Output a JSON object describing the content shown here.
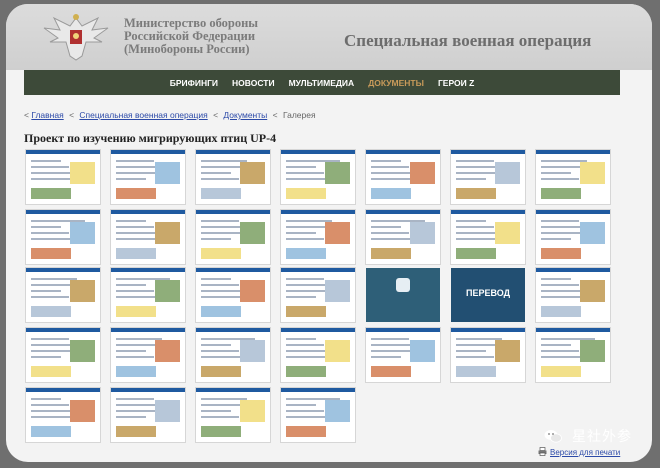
{
  "header": {
    "ministry_line1": "Министерство обороны",
    "ministry_line2": "Российской Федерации",
    "ministry_line3": "(Минобороны России)",
    "site_title": "Специальная военная операция",
    "emblem_icon": "double-headed-eagle-emblem"
  },
  "nav": {
    "items": [
      {
        "label": "БРИФИНГИ",
        "active": false
      },
      {
        "label": "НОВОСТИ",
        "active": false
      },
      {
        "label": "МУЛЬТИМЕДИА",
        "active": false
      },
      {
        "label": "ДОКУМЕНТЫ",
        "active": true
      },
      {
        "label": "ГЕРОИ Z",
        "active": false
      }
    ],
    "active_color": "#c89a5a",
    "bar_color": "#3d4a39"
  },
  "breadcrumb": {
    "prefix": "<",
    "home": "Главная",
    "sep": "<",
    "section": "Специальная военная операция",
    "documents": "Документы",
    "current": "Галерея"
  },
  "gallery": {
    "title": "Проект по изучению мигрирующих птиц UP-4",
    "translate_label": "ПЕРЕВОД"
  },
  "footer": {
    "watermark_text": "星社外参",
    "watermark_icon": "wechat-icon",
    "print_label": "Версия для печати",
    "print_icon": "printer-icon"
  }
}
